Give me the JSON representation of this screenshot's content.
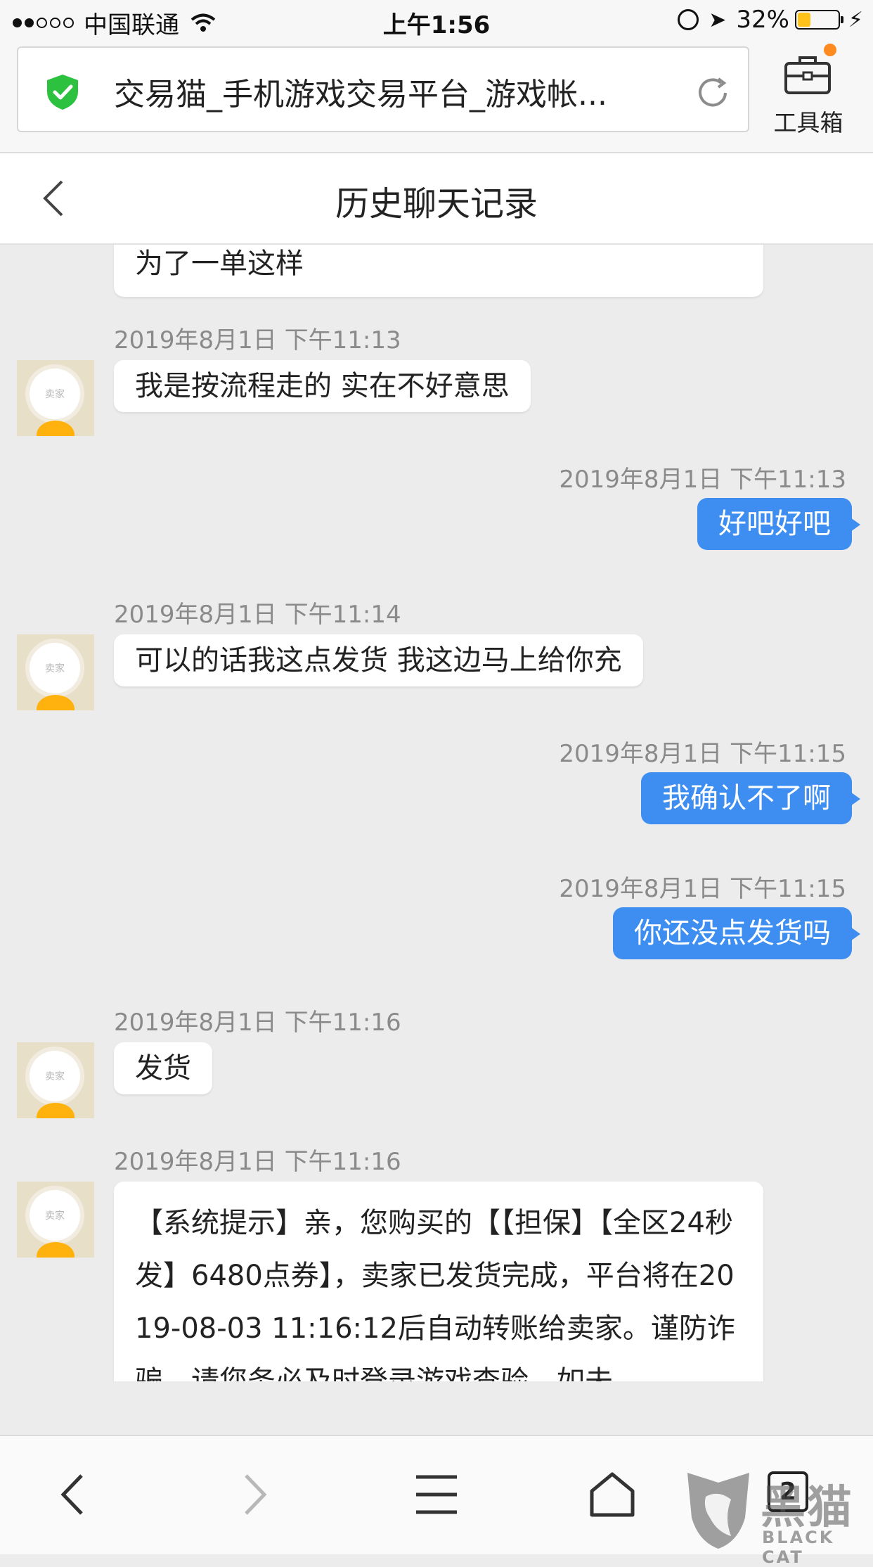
{
  "status_bar": {
    "carrier": "中国联通",
    "time": "上午1:56",
    "battery": "32%",
    "battery_level": 0.32
  },
  "browser": {
    "url_title": "交易猫_手机游戏交易平台_游戏帐...",
    "toolbox_label": "工具箱",
    "tab_count": "2"
  },
  "page": {
    "title": "历史聊天记录"
  },
  "chat": {
    "messages": [
      {
        "side": "in",
        "text": "为了一单这样"
      },
      {
        "side": "in",
        "timestamp": "2019年8月1日 下午11:13",
        "sender_avatar_label": "卖家",
        "text": "我是按流程走的 实在不好意思"
      },
      {
        "side": "out",
        "timestamp": "2019年8月1日 下午11:13",
        "text": "好吧好吧"
      },
      {
        "side": "in",
        "timestamp": "2019年8月1日 下午11:14",
        "sender_avatar_label": "卖家",
        "text": "可以的话我这点发货 我这边马上给你充"
      },
      {
        "side": "out",
        "timestamp": "2019年8月1日 下午11:15",
        "text": "我确认不了啊"
      },
      {
        "side": "out",
        "timestamp": "2019年8月1日 下午11:15",
        "text": "你还没点发货吗"
      },
      {
        "side": "in",
        "timestamp": "2019年8月1日 下午11:16",
        "sender_avatar_label": "卖家",
        "text": "发货"
      },
      {
        "side": "in",
        "timestamp": "2019年8月1日 下午11:16",
        "sender_avatar_label": "卖家",
        "text": "【系统提示】亲，您购买的【【担保】【全区24秒发】6480点券】，卖家已发货完成，平台将在2019-08-03 11:16:12后自动转账给卖家。谨防诈骗，请您务必及时登录游戏查验，如未"
      }
    ]
  },
  "watermark": {
    "cn": "黑猫",
    "en": "BLACK CAT"
  },
  "colors": {
    "outgoing_bubble": "#3d8ef0",
    "shield_green": "#2cc13e",
    "notify_dot": "#ff8a1f",
    "avatar_body": "#ffb20e"
  }
}
